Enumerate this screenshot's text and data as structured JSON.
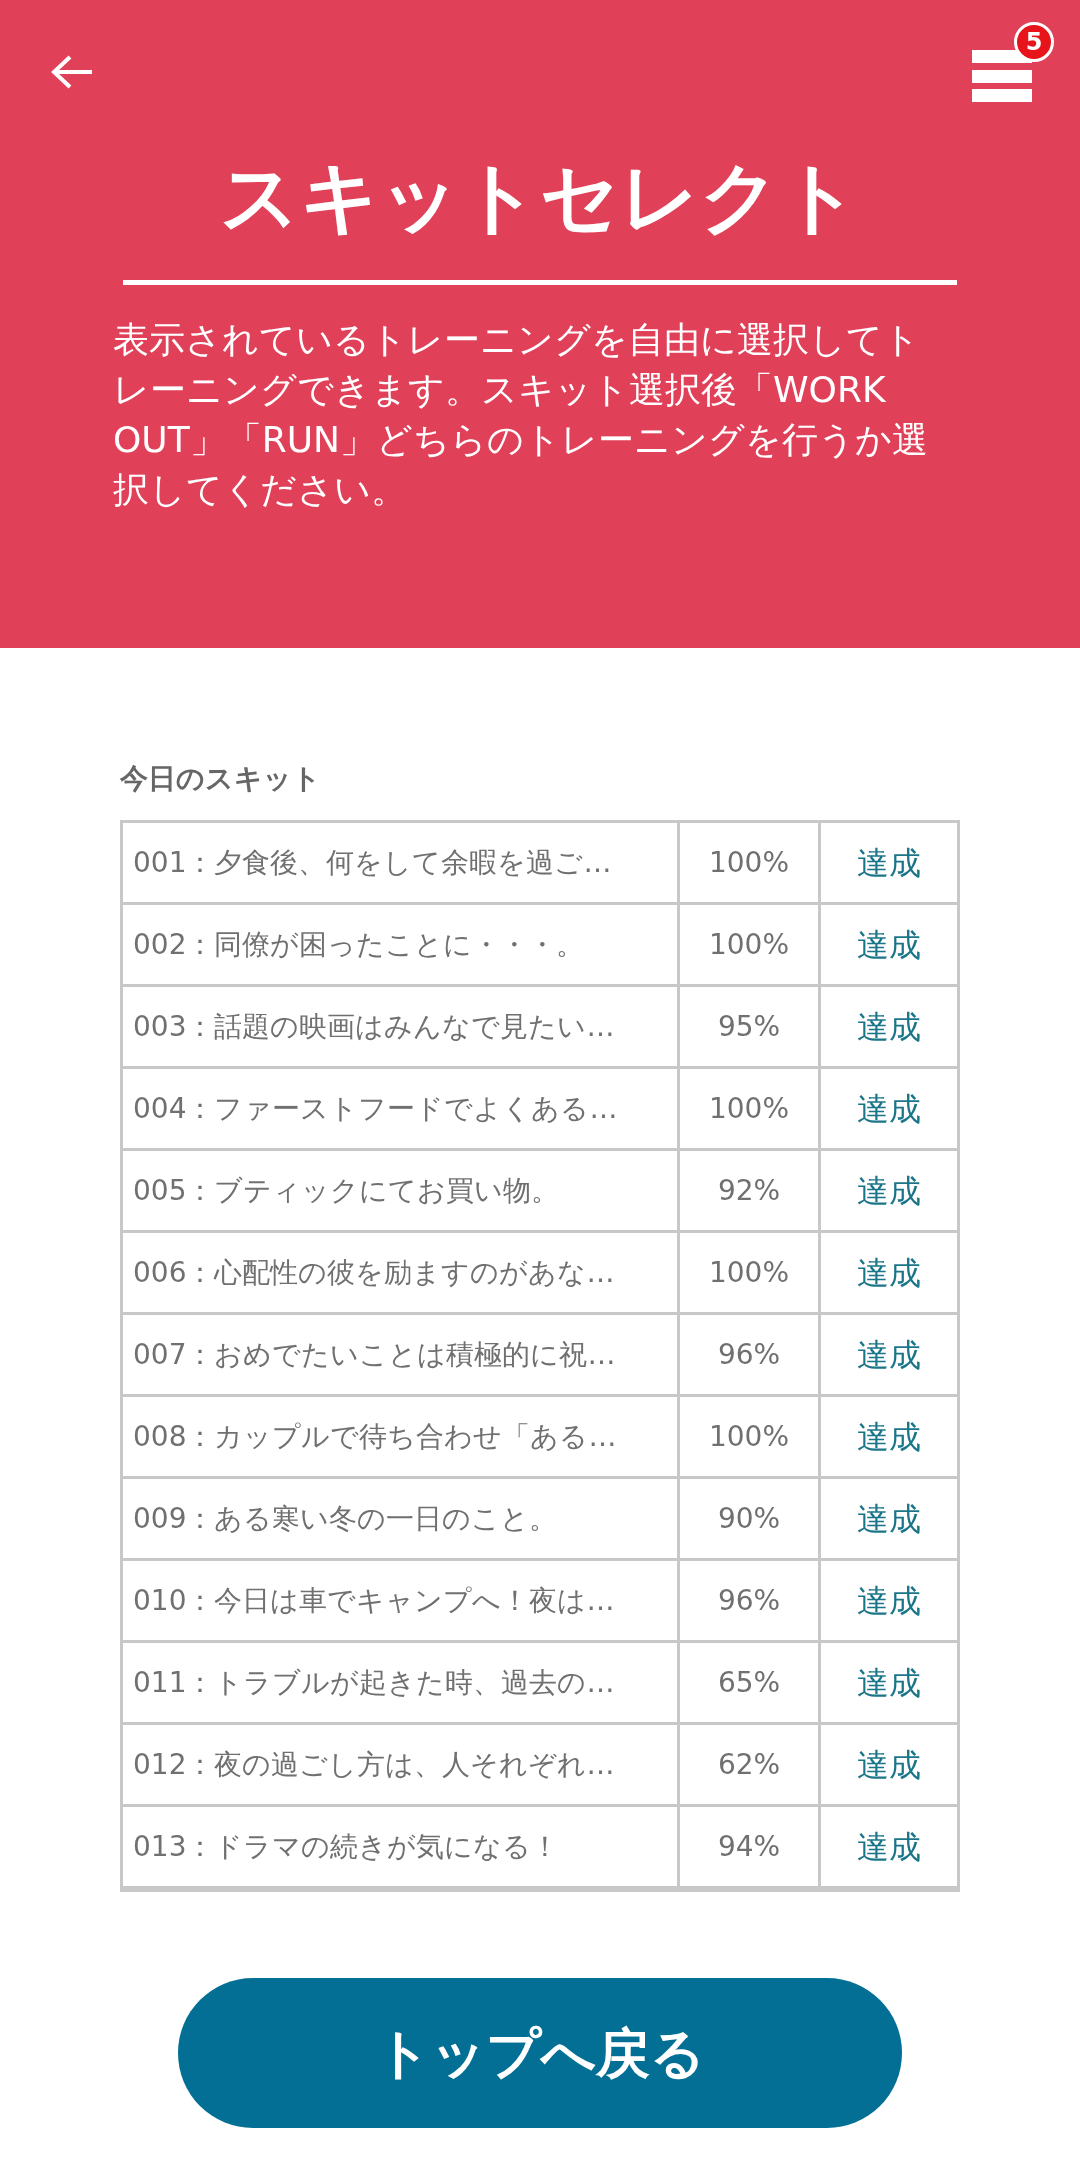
{
  "header": {
    "badge": "5",
    "title": "スキットセレクト",
    "description": "表示されているトレーニングを自由に選択してトレーニングできます。スキット選択後「WORK OUT」「RUN」どちらのトレーニングを行うか選択してください。"
  },
  "section_label": "今日のスキット",
  "table": {
    "rows": [
      {
        "title": "001：夕食後、何をして余暇を過ご…",
        "score": "100%",
        "status": "達成"
      },
      {
        "title": "002：同僚が困ったことに・・・。",
        "score": "100%",
        "status": "達成"
      },
      {
        "title": "003：話題の映画はみんなで見たい…",
        "score": "95%",
        "status": "達成"
      },
      {
        "title": "004：ファーストフードでよくある…",
        "score": "100%",
        "status": "達成"
      },
      {
        "title": "005：ブティックにてお買い物。",
        "score": "92%",
        "status": "達成"
      },
      {
        "title": "006：心配性の彼を励ますのがあな…",
        "score": "100%",
        "status": "達成"
      },
      {
        "title": "007：おめでたいことは積極的に祝…",
        "score": "96%",
        "status": "達成"
      },
      {
        "title": "008：カップルで待ち合わせ「ある…",
        "score": "100%",
        "status": "達成"
      },
      {
        "title": "009：ある寒い冬の一日のこと。",
        "score": "90%",
        "status": "達成"
      },
      {
        "title": "010：今日は車でキャンプへ！夜は…",
        "score": "96%",
        "status": "達成"
      },
      {
        "title": "011：トラブルが起きた時、過去の…",
        "score": "65%",
        "status": "達成"
      },
      {
        "title": "012：夜の過ごし方は、人それぞれ…",
        "score": "62%",
        "status": "達成"
      },
      {
        "title": "013：ドラマの続きが気になる！",
        "score": "94%",
        "status": "達成"
      }
    ]
  },
  "button": "トップへ戻る"
}
